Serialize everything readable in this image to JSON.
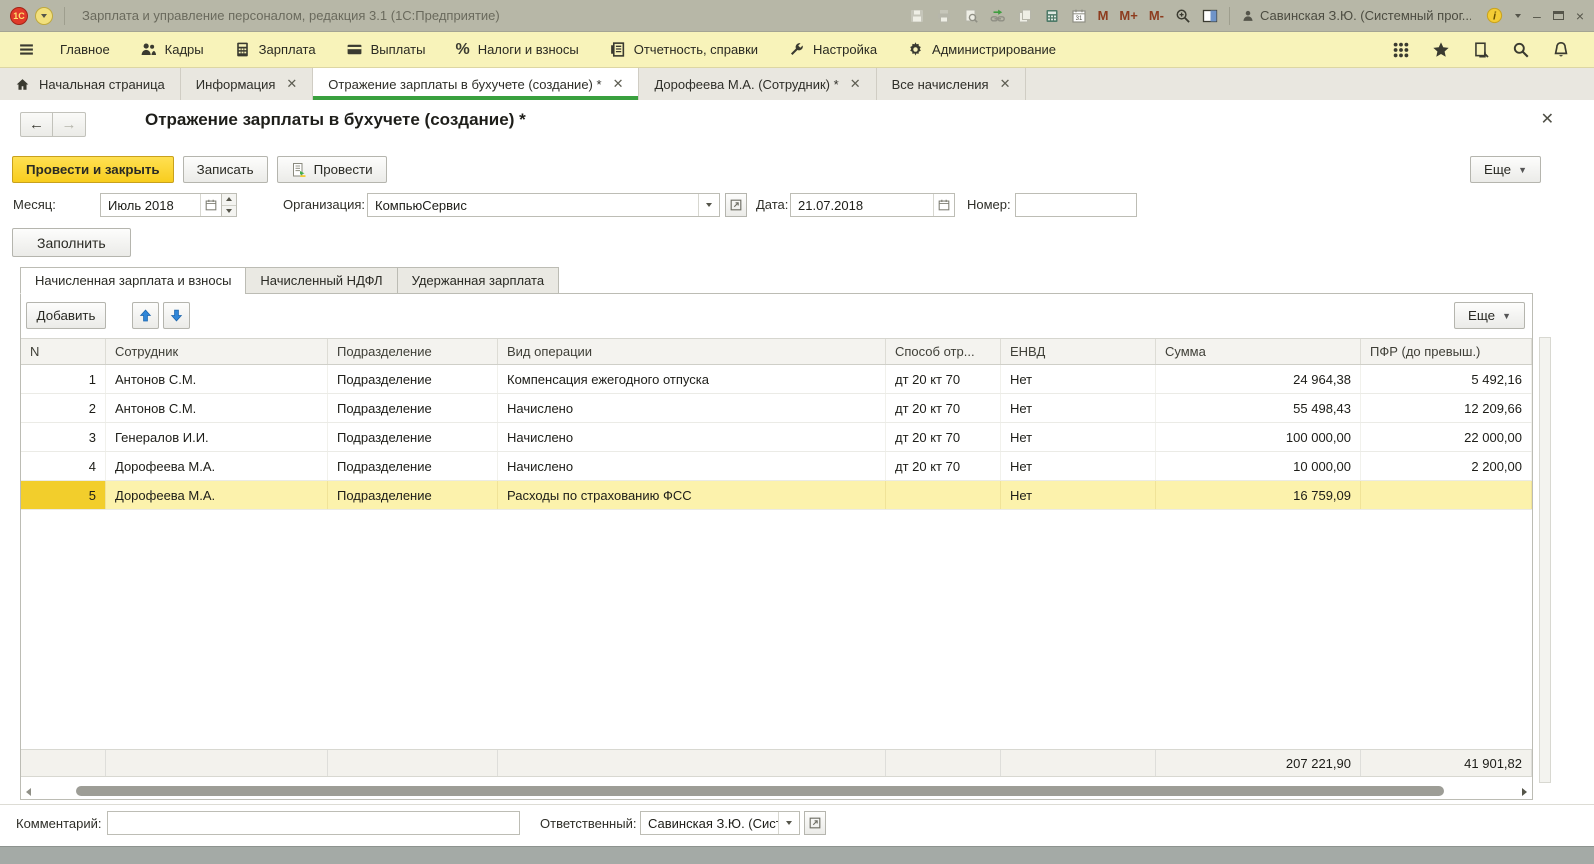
{
  "colors": {
    "accent_yellow": "#f8cd1e",
    "selected_row": "#fcf2ac",
    "active_tab_green": "#39a03e",
    "menubar_yellow": "#f8f3ba",
    "titlebar_gray": "#b7b7a7"
  },
  "title_bar": {
    "app_title": "Зарплата и управление персоналом, редакция 3.1  (1С:Предприятие)",
    "logo_text": "1С",
    "tools": [
      {
        "icon": "save-icon"
      },
      {
        "icon": "print-icon"
      },
      {
        "icon": "print-preview-icon"
      },
      {
        "icon": "link-icon"
      },
      {
        "icon": "copy-link-icon"
      },
      {
        "icon": "calculator-icon"
      },
      {
        "icon": "calendar-icon"
      },
      {
        "text": "M"
      },
      {
        "text": "M+"
      },
      {
        "text": "M-"
      },
      {
        "icon": "zoom-icon"
      },
      {
        "icon": "panels-icon"
      }
    ],
    "user": "Савинская З.Ю. (Системный прог...",
    "window_buttons": {
      "minimize": "–",
      "close": "×"
    }
  },
  "menu": {
    "items": [
      {
        "icon": "hamburger-icon",
        "label": ""
      },
      {
        "icon": "",
        "label": "Главное"
      },
      {
        "icon": "people-icon",
        "label": "Кадры"
      },
      {
        "icon": "calculator-dark-icon",
        "label": "Зарплата"
      },
      {
        "icon": "card-icon",
        "label": "Выплаты"
      },
      {
        "icon": "percent-icon",
        "label": "Налоги и взносы"
      },
      {
        "icon": "report-icon",
        "label": "Отчетность, справки"
      },
      {
        "icon": "wrench-icon",
        "label": "Настройка"
      },
      {
        "icon": "gear-icon",
        "label": "Администрирование"
      }
    ],
    "right_icons": [
      "apps-grid-icon",
      "favorites-star-icon",
      "history-icon",
      "search-icon",
      "notifications-bell-icon"
    ]
  },
  "tabs": [
    {
      "label": "Начальная страница",
      "icon": "home-icon",
      "closable": false,
      "active": false
    },
    {
      "label": "Информация",
      "closable": true,
      "active": false
    },
    {
      "label": "Отражение зарплаты в бухучете (создание) *",
      "closable": true,
      "active": true
    },
    {
      "label": "Дорофеева М.А. (Сотрудник) *",
      "closable": true,
      "active": false
    },
    {
      "label": "Все начисления",
      "closable": true,
      "active": false
    }
  ],
  "form": {
    "title": "Отражение зарплаты в бухучете (создание) *",
    "buttons": {
      "post_close": "Провести и закрыть",
      "write": "Записать",
      "post": "Провести",
      "more": "Еще",
      "fill": "Заполнить",
      "add": "Добавить"
    },
    "fields": {
      "month_label": "Месяц:",
      "month_value": "Июль 2018",
      "org_label": "Организация:",
      "org_value": "КомпьюСервис",
      "date_label": "Дата:",
      "date_value": "21.07.2018",
      "number_label": "Номер:",
      "number_value": ""
    },
    "tabs": [
      {
        "label": "Начисленная зарплата и взносы",
        "active": true
      },
      {
        "label": "Начисленный НДФЛ",
        "active": false
      },
      {
        "label": "Удержанная зарплата",
        "active": false
      }
    ],
    "table": {
      "columns": [
        "N",
        "Сотрудник",
        "Подразделение",
        "Вид операции",
        "Способ отр...",
        "ЕНВД",
        "Сумма",
        "ПФР (до превыш.)"
      ],
      "rows": [
        {
          "n": "1",
          "employee": "Антонов С.М.",
          "department": "Подразделение",
          "operation": "Компенсация ежегодного отпуска",
          "method": "дт 20 кт 70",
          "envd": "Нет",
          "sum": "24 964,38",
          "pfr": "5 492,16",
          "selected": false
        },
        {
          "n": "2",
          "employee": "Антонов С.М.",
          "department": "Подразделение",
          "operation": "Начислено",
          "method": "дт 20 кт 70",
          "envd": "Нет",
          "sum": "55 498,43",
          "pfr": "12 209,66",
          "selected": false
        },
        {
          "n": "3",
          "employee": "Генералов И.И.",
          "department": "Подразделение",
          "operation": "Начислено",
          "method": "дт 20 кт 70",
          "envd": "Нет",
          "sum": "100 000,00",
          "pfr": "22 000,00",
          "selected": false
        },
        {
          "n": "4",
          "employee": "Дорофеева М.А.",
          "department": "Подразделение",
          "operation": "Начислено",
          "method": "дт 20 кт 70",
          "envd": "Нет",
          "sum": "10 000,00",
          "pfr": "2 200,00",
          "selected": false
        },
        {
          "n": "5",
          "employee": "Дорофеева М.А.",
          "department": "Подразделение",
          "operation": "Расходы по страхованию ФСС",
          "method": "",
          "envd": "Нет",
          "sum": "16 759,09",
          "pfr": "",
          "selected": true
        }
      ],
      "totals": {
        "sum": "207 221,90",
        "pfr": "41 901,82"
      }
    },
    "footer": {
      "comment_label": "Комментарий:",
      "comment_value": "",
      "responsible_label": "Ответственный:",
      "responsible_value": "Савинская З.Ю. (Системн"
    }
  }
}
